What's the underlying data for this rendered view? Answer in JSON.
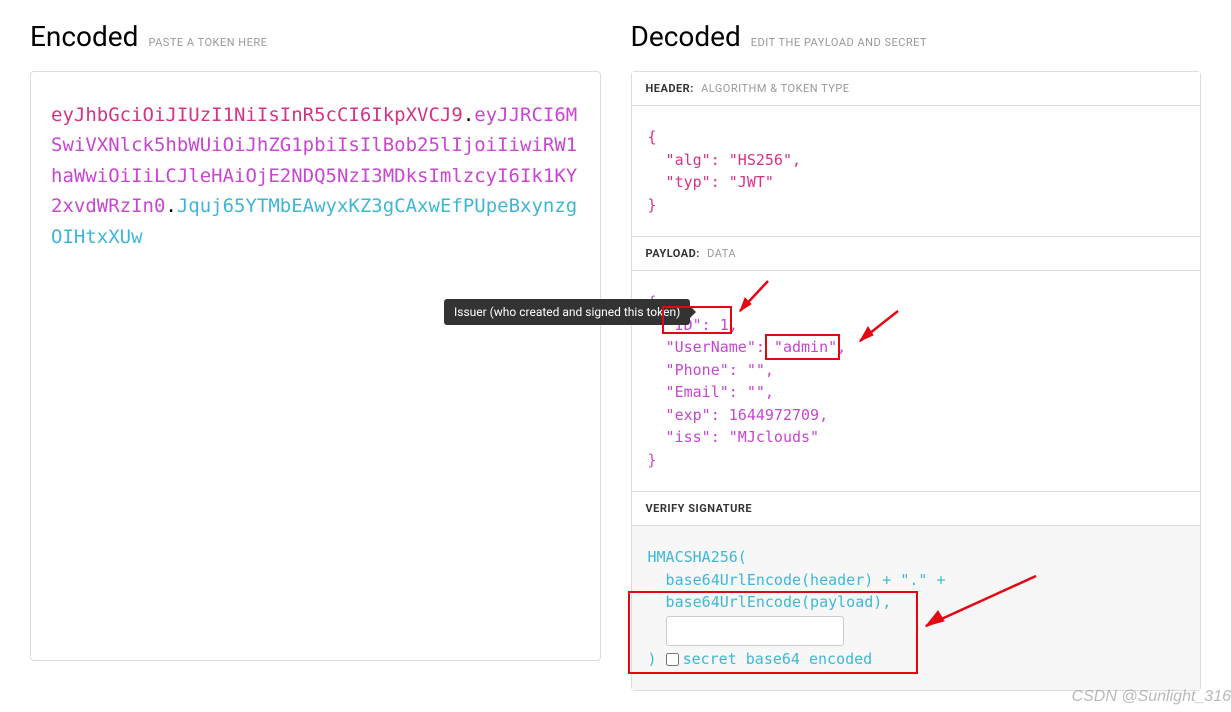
{
  "encoded": {
    "title": "Encoded",
    "subtitle": "PASTE A TOKEN HERE",
    "token_header": "eyJhbGciOiJIUzI1NiIsInR5cCI6IkpXVCJ9",
    "token_payload": "eyJJRCI6MSwiVXNlck5hbWUiOiJhZG1pbiIsIlBob25lIjoiIiwiRW1haWwiOiIiLCJleHAiOjE2NDQ5NzI3MDksImlzcyI6Ik1KY2xvdWRzIn0",
    "token_signature": "Jquj65YTMbEAwyxKZ3gCAxwEfPUpeBxynzgOIHtxXUw",
    "dot": "."
  },
  "decoded": {
    "title": "Decoded",
    "subtitle": "EDIT THE PAYLOAD AND SECRET"
  },
  "header_section": {
    "label": "HEADER:",
    "sublabel": "ALGORITHM & TOKEN TYPE",
    "code": "{\n  \"alg\": \"HS256\",\n  \"typ\": \"JWT\"\n}"
  },
  "payload_section": {
    "label": "PAYLOAD:",
    "sublabel": "DATA",
    "open": "{",
    "id_line": "\"ID\": 1,",
    "username_key": "\"UserName\":",
    "username_val": " \"admin\",",
    "phone_line": "  \"Phone\": \"\",",
    "email_line": "  \"Email\": \"\",",
    "exp_line": "  \"exp\": 1644972709,",
    "iss_line": "  \"iss\": \"MJclouds\"",
    "close": "}"
  },
  "signature_section": {
    "label": "VERIFY SIGNATURE",
    "line1": "HMACSHA256(",
    "line2": "  base64UrlEncode(header) + \".\" +",
    "line3": "  base64UrlEncode(payload),",
    "line5_prefix": ") ",
    "checkbox_label": "secret base64 encoded"
  },
  "tooltip_text": "Issuer (who created and signed this token)",
  "watermark": "CSDN @Sunlight_316"
}
